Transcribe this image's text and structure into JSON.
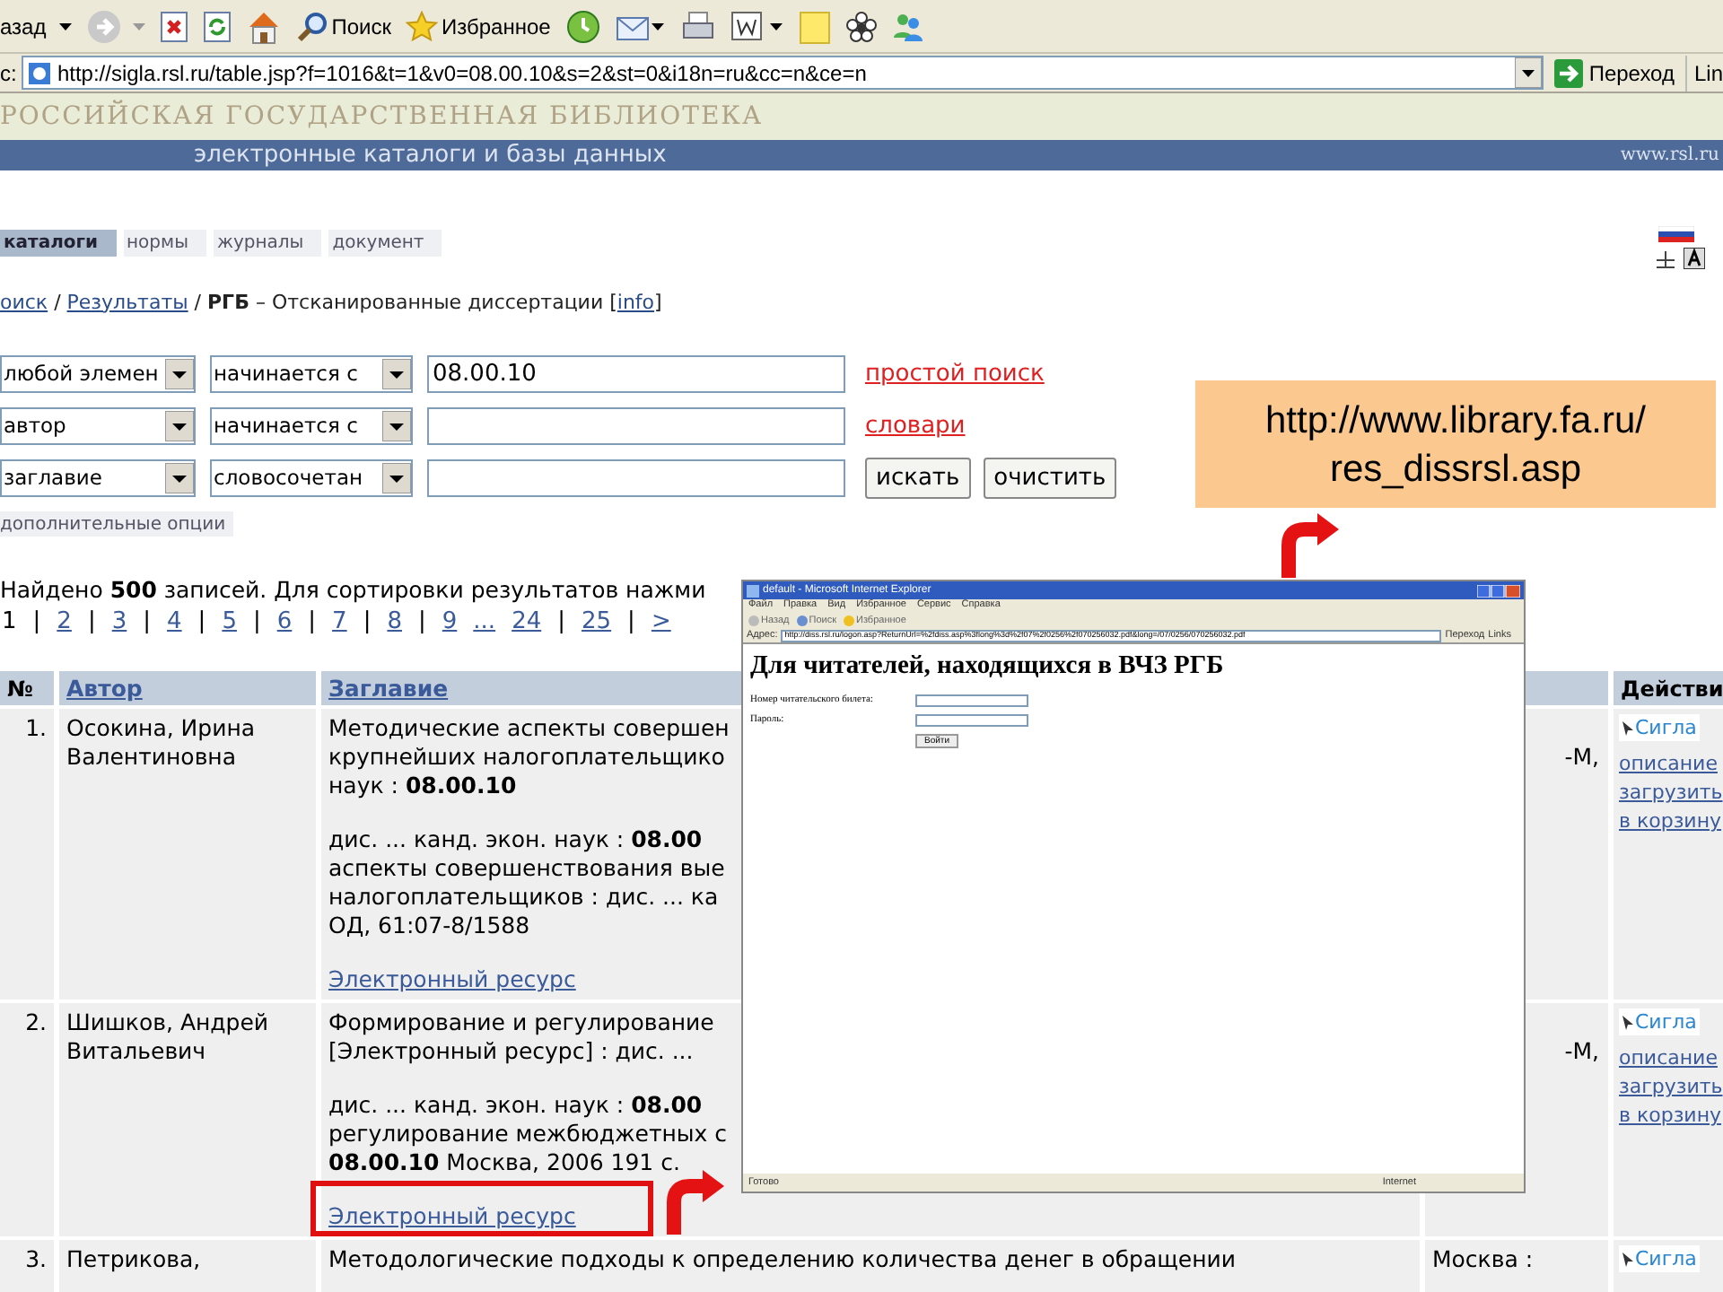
{
  "browser": {
    "toolbar": [
      {
        "kind": "back",
        "label": "азад"
      },
      {
        "kind": "forward"
      },
      {
        "kind": "stop"
      },
      {
        "kind": "refresh"
      },
      {
        "kind": "home"
      },
      {
        "kind": "search",
        "label": "Поиск"
      },
      {
        "kind": "favorites",
        "label": "Избранное"
      },
      {
        "kind": "history"
      },
      {
        "kind": "mail"
      },
      {
        "kind": "print"
      },
      {
        "kind": "word"
      },
      {
        "kind": "note"
      },
      {
        "kind": "flower"
      },
      {
        "kind": "people"
      }
    ],
    "address_label": "c:",
    "url": "http://sigla.rsl.ru/table.jsp?f=1016&t=1&v0=08.00.10&s=2&st=0&i18n=ru&cc=n&ce=n",
    "go_button": "Переход",
    "links": "Lin"
  },
  "site": {
    "banner_title": "РОССИЙСКАЯ ГОСУДАРСТВЕННАЯ БИБЛИОТЕКА",
    "subtitle": "электронные каталоги и базы данных",
    "site_url": "www.rsl.ru"
  },
  "tabs": [
    {
      "label": "каталоги",
      "selected": true
    },
    {
      "label": "нормы",
      "selected": false
    },
    {
      "label": "журналы",
      "selected": false
    },
    {
      "label": "документ",
      "selected": false
    }
  ],
  "breadcrumb": [
    {
      "kind": "link",
      "text": "оиск"
    },
    {
      "kind": "plain",
      "text": " / "
    },
    {
      "kind": "link",
      "text": "Результаты"
    },
    {
      "kind": "plain",
      "text": " / **РГБ** – Отсканированные диссертации ["
    },
    {
      "kind": "link",
      "text": "info"
    },
    {
      "kind": "plain",
      "text": "]"
    }
  ],
  "search_form": [
    {
      "field": "любой элемен",
      "operator": "начинается с",
      "value": "08.00.10",
      "link": "простой поиск"
    },
    {
      "field": "автор",
      "operator": "начинается с",
      "link": "словари"
    },
    {
      "field": "заглавие",
      "operator": "словосочетан",
      "buttons": [
        "искать",
        "очистить"
      ]
    }
  ],
  "options_tab": "дополнительные опции",
  "results": {
    "summary": "Найдено **500** записей. Для сортировки результатов нажми",
    "pages": [
      {
        "label": "1",
        "selected": true,
        "separator": "|"
      },
      {
        "label": "2",
        "selected": false,
        "separator": "|"
      },
      {
        "label": "3",
        "selected": false,
        "separator": "|"
      },
      {
        "label": "4",
        "selected": false,
        "separator": "|"
      },
      {
        "label": "5",
        "selected": false,
        "separator": "|"
      },
      {
        "label": "6",
        "selected": false,
        "separator": "|"
      },
      {
        "label": "7",
        "selected": false,
        "separator": "|"
      },
      {
        "label": "8",
        "selected": false,
        "separator": "|"
      },
      {
        "label": "9",
        "selected": false
      },
      {
        "label": "...",
        "selected": false
      },
      {
        "label": "24",
        "selected": false,
        "separator": "|"
      },
      {
        "label": "25",
        "selected": false,
        "separator": "|"
      },
      {
        "label": ">",
        "selected": false
      }
    ]
  },
  "table": {
    "columns": [
      {
        "kind": "plain",
        "label": "№"
      },
      {
        "kind": "link",
        "label": "Автор"
      },
      {
        "kind": "link",
        "label": "Заглавие"
      },
      {
        "kind": "blank"
      },
      {
        "kind": "plain",
        "label": "Действи"
      }
    ],
    "rows": [
      {
        "number": "1.",
        "author": "Осокина, Ирина\nВалентиновна",
        "title": [
          "Методические аспекты совершен\nкрупнейших налогоплательщико\nнаук : **08.00.10**",
          "дис. ... канд. экон. наук : **08.00**\nаспекты совершенствования вые\nналогоплательщиков : дис. ... ка\nОД, 61:07-8/1588"
        ],
        "resource_link": "Электронный ресурс",
        "marked": false,
        "column_4": "-М,",
        "badge": "Сигла",
        "actions": [
          "описание",
          "загрузить",
          "в корзину"
        ]
      },
      {
        "number": "2.",
        "author": "Шишков, Андрей\nВитальевич",
        "title": [
          "Формирование и регулирование\n[Электронный ресурс] : дис. ...",
          "дис. ... канд. экон. наук : **08.00**\nрегулирование межбюджетных с\n**08.00.10** Москва, 2006 191 с."
        ],
        "resource_link": "Электронный ресурс",
        "marked": true,
        "column_4": "-М,",
        "badge": "Сигла",
        "actions": [
          "описание",
          "загрузить",
          "в корзину"
        ]
      },
      {
        "number": "3.",
        "author": "Петрикова,",
        "title": [
          "Методологические подходы к определению количества денег в обращении"
        ],
        "marked": false,
        "column_4": "Москва :",
        "badge": "Сигла",
        "actions": []
      }
    ]
  },
  "inset_window": {
    "title": "default - Microsoft Internet Explorer",
    "menu": [
      "Файл",
      "Правка",
      "Вид",
      "Избранное",
      "Сервис",
      "Справка"
    ],
    "toolbar": [
      "Назад",
      "Поиск",
      "Избранное"
    ],
    "address_label": "Адрес:",
    "url": "http://diss.rsl.ru/logon.asp?ReturnUrl=%2fdiss.asp%3flong%3d%2f07%2f0256%2f070256032.pdf&long=/07/0256/070256032.pdf",
    "go_button": "Переход",
    "links": "Links",
    "heading": "Для читателей, находящихся в ВЧЗ РГБ",
    "fields": [
      {
        "label": "Номер читательского билета:"
      },
      {
        "label": "Пароль:"
      }
    ],
    "submit": "Войти",
    "status": "Готово",
    "zone": "Internet"
  },
  "callout": {
    "text": "http://www.library.fa.ru/\nres_dissrsl.asp"
  }
}
